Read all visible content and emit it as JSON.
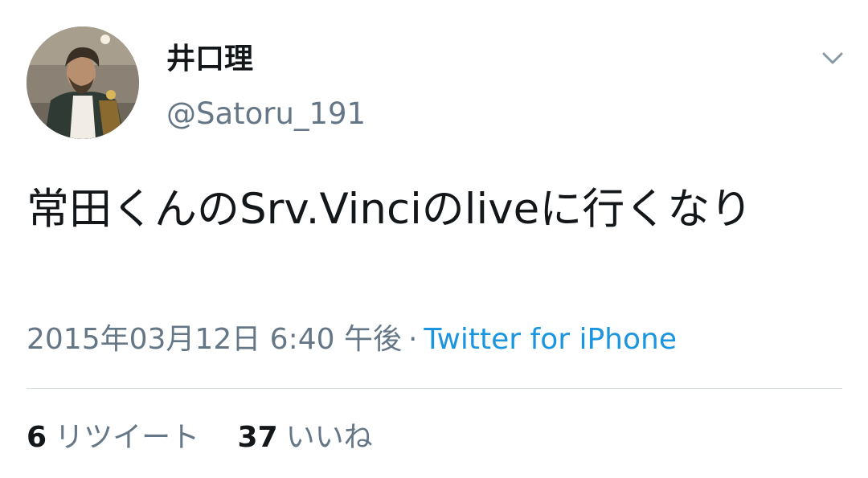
{
  "tweet": {
    "author": {
      "display_name": "井口理",
      "handle": "@Satoru_191",
      "avatar_icon": "user-avatar-photo"
    },
    "menu_icon": "chevron-down-icon",
    "text": "常田くんのSrv.Vinciのliveに行くなり",
    "meta": {
      "timestamp": "2015年03月12日 6:40 午後",
      "separator": "·",
      "source": "Twitter for iPhone"
    },
    "stats": {
      "retweets_count": "6",
      "retweets_label": "リツイート",
      "likes_count": "37",
      "likes_label": "いいね"
    },
    "colors": {
      "text": "#14171a",
      "secondary": "#657786",
      "link": "#1b95e0",
      "divider": "#d6dde3"
    }
  }
}
